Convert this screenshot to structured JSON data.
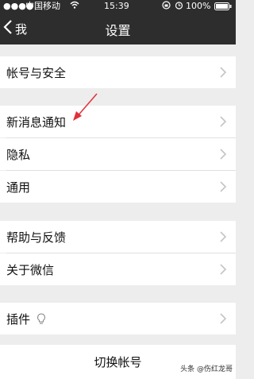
{
  "status_bar": {
    "carrier": "中国移动",
    "time": "15:39",
    "battery": "100%"
  },
  "nav": {
    "back_label": "我",
    "title": "设置"
  },
  "sections": [
    {
      "items": [
        {
          "label": "帐号与安全"
        }
      ]
    },
    {
      "items": [
        {
          "label": "新消息通知"
        },
        {
          "label": "隐私"
        },
        {
          "label": "通用"
        }
      ]
    },
    {
      "items": [
        {
          "label": "帮助与反馈"
        },
        {
          "label": "关于微信"
        }
      ]
    },
    {
      "items": [
        {
          "label": "插件"
        }
      ]
    }
  ],
  "switch_account": "切换帐号",
  "watermark": "头条 @伤红龙哥",
  "accent_arrow_color": "#e0303a"
}
